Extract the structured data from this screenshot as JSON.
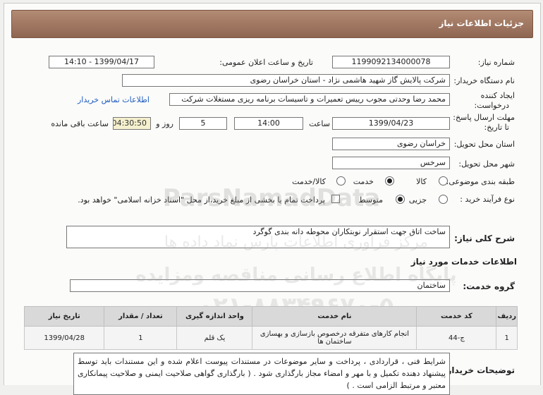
{
  "header": {
    "title": "جزئیات اطلاعات نیاز"
  },
  "need_number": {
    "label": "شماره نیاز:",
    "value": "1199092134000078"
  },
  "announce": {
    "label": "تاریخ و ساعت اعلان عمومی:",
    "value": "1399/04/17 - 14:10"
  },
  "buyer_org": {
    "label": "نام دستگاه خریدار:",
    "value": "شرکت پالایش گاز شهید هاشمی نژاد - استان خراسان رضوی"
  },
  "creator": {
    "label_line1": "ایجاد کننده",
    "label_line2": "درخواست:",
    "value": "محمد رضا وحدتی مجوب رییس تعمیرات و تاسیسات برنامه ریزی مستغلات شرکت",
    "contact_link": "اطلاعات تماس خریدار"
  },
  "deadline": {
    "label_line1": "مهلت ارسال پاسخ:",
    "label_line2": "تا تاریخ:",
    "date": "1399/04/23",
    "time_label": "ساعت",
    "time": "14:00",
    "days": "5",
    "days_label": "روز و",
    "remaining": "04:30:50",
    "remaining_label": "ساعت باقی مانده"
  },
  "province": {
    "label": "استان محل تحویل:",
    "value": "خراسان رضوی"
  },
  "city": {
    "label": "شهر محل تحویل:",
    "value": "سرخس"
  },
  "category": {
    "label": "طبقه بندی موضوعی:",
    "options": [
      "کالا",
      "خدمت",
      "کالا/خدمت"
    ],
    "selected": "خدمت"
  },
  "process": {
    "label": "نوع فرآیند خرید :",
    "options": [
      "جزیی",
      "متوسط"
    ],
    "selected": "متوسط",
    "payment_note": "پرداخت تمام یا بخشی از مبلغ خرید،از محل \"اسناد خزانه اسلامی\" خواهد بود."
  },
  "summary": {
    "label": "شرح کلی نیاز:",
    "value": "ساخت اتاق جهت استقرار نوبتکاران محوطه دانه بندی گوگرد"
  },
  "services_title": "اطلاعات خدمات مورد نیاز",
  "service_group": {
    "label": "گروه خدمت:",
    "value": "ساختمان"
  },
  "table": {
    "headers": [
      "ردیف",
      "کد خدمت",
      "نام خدمت",
      "واحد اندازه گیری",
      "تعداد / مقدار",
      "تاریخ نیاز"
    ],
    "rows": [
      [
        "1",
        "ج-44",
        "انجام کارهای متفرقه درخصوص بازسازی و بهسازی ساختمان ها",
        "یک قلم",
        "1",
        "1399/04/28"
      ]
    ]
  },
  "buyer_notes": {
    "label": "توضیحات خریدار:",
    "value": "شرایط فنی ، قراردادی ، پرداخت و سایر موضوعات در مستندات پیوست اعلام شده و این مستندات باید توسط پیشنهاد دهنده تکمیل و با مهر و امضاء مجاز بارگذاری شود . ( بارگذاری گواهی صلاحیت ایمنی و صلاحیت پیمانکاری معتبر و مرتبط الزامی است . )"
  },
  "watermark": {
    "brand": "ParsNamadData",
    "line1": "مرکز فراوری اطلاعات پارس نماد داده ها",
    "line2": "پایگاه اطلاع رسانی مناقصه ومزایده",
    "phone": "۰۲۱-۸۸۳۴۹۶۷۰-۵"
  },
  "colors": {
    "header_bg": "#9a715c",
    "link": "#1f5cc0",
    "remaining_bg": "#f5f0cd"
  }
}
